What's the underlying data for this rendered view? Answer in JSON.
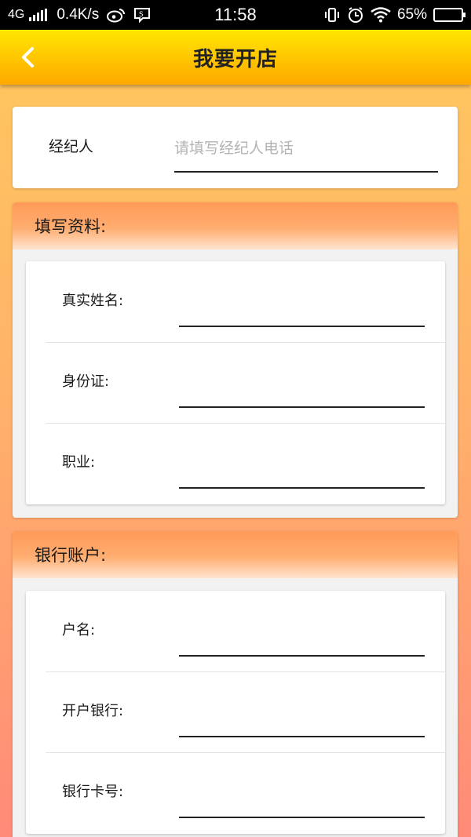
{
  "status_bar": {
    "network": "4G",
    "speed": "0.4K/s",
    "time": "11:58",
    "battery_text": "65%",
    "battery_level": 0.65
  },
  "header": {
    "title": "我要开店",
    "back_icon": "chevron-left-icon"
  },
  "agent": {
    "label": "经纪人",
    "placeholder": "请填写经纪人电话",
    "value": ""
  },
  "profile_section": {
    "title": "填写资料:",
    "fields": [
      {
        "label": "真实姓名:",
        "value": ""
      },
      {
        "label": "身份证:",
        "value": ""
      },
      {
        "label": "职业:",
        "value": ""
      }
    ]
  },
  "bank_section": {
    "title": "银行账户:",
    "fields": [
      {
        "label": "户名:",
        "value": ""
      },
      {
        "label": "开户银行:",
        "value": ""
      },
      {
        "label": "银行卡号:",
        "value": ""
      }
    ]
  },
  "colors": {
    "header_top": "#ffe600",
    "header_bottom": "#ffa800",
    "section_head": "#ff9a58",
    "background_top": "#ffc95c",
    "background_bottom": "#ff8a78"
  }
}
